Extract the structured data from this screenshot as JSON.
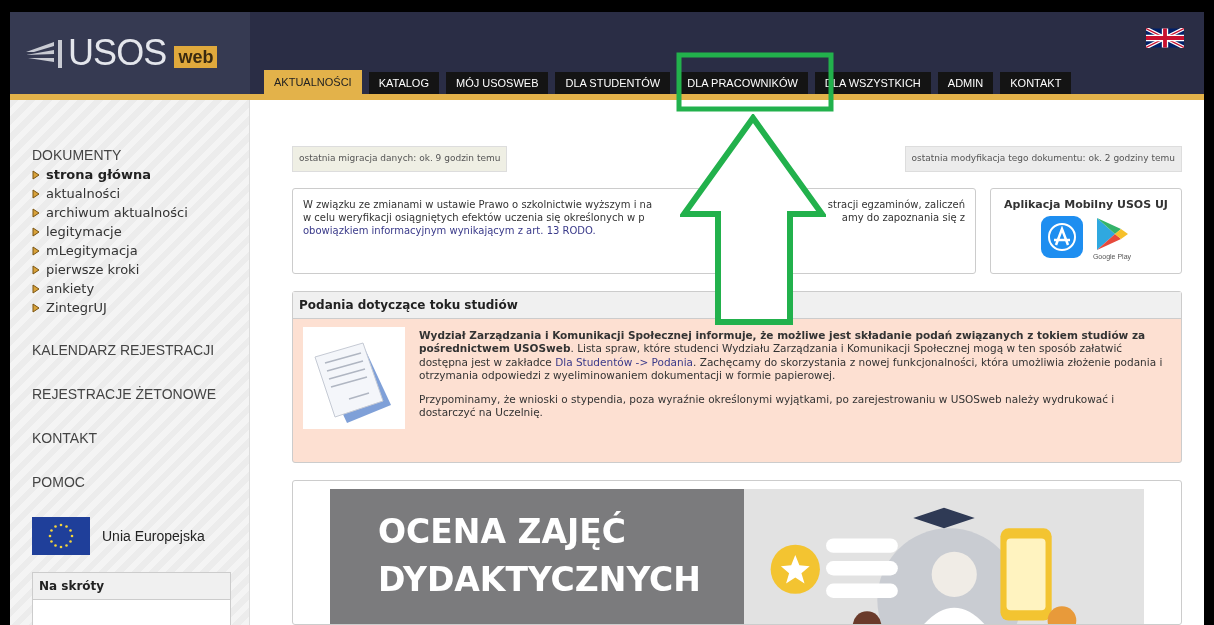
{
  "header": {
    "logo_text": "USOS",
    "logo_badge": "web"
  },
  "nav_tabs": [
    {
      "label": "AKTUALNOŚCI",
      "selected": true
    },
    {
      "label": "KATALOG",
      "selected": false
    },
    {
      "label": "MÓJ USOSWEB",
      "selected": false
    },
    {
      "label": "DLA STUDENTÓW",
      "selected": false
    },
    {
      "label": "DLA PRACOWNIKÓW",
      "selected": false
    },
    {
      "label": "DLA WSZYSTKICH",
      "selected": false
    },
    {
      "label": "ADMIN",
      "selected": false
    },
    {
      "label": "KONTAKT",
      "selected": false
    }
  ],
  "sidebar": {
    "sections": [
      {
        "title": "DOKUMENTY",
        "items": [
          {
            "label": "strona główna",
            "selected": true
          },
          {
            "label": "aktualności",
            "selected": false
          },
          {
            "label": "archiwum aktualności",
            "selected": false
          },
          {
            "label": "legitymacje",
            "selected": false
          },
          {
            "label": "mLegitymacja",
            "selected": false
          },
          {
            "label": "pierwsze kroki",
            "selected": false
          },
          {
            "label": "ankiety",
            "selected": false
          },
          {
            "label": "ZintegrUJ",
            "selected": false
          }
        ]
      },
      {
        "title": "KALENDARZ REJESTRACJI"
      },
      {
        "title": "REJESTRACJE ŻETONOWE"
      },
      {
        "title": "KONTAKT"
      },
      {
        "title": "POMOC"
      }
    ],
    "eu_label": "Unia Europejska",
    "shortcuts_title": "Na skróty"
  },
  "status": {
    "migration": "ostatnia migracja danych: ok. 9 godzin temu",
    "modification": "ostatnia modyfikacja tego dokumentu: ok. 2 godziny temu"
  },
  "notice": {
    "lines": [
      {
        "left": "W związku ze zmianami w ustawie Prawo o szkolnictwie wyższym i na",
        "right": "stracji egzaminów, zaliczeń"
      },
      {
        "left": "w celu weryfikacji osiągniętych efektów uczenia się określonych w p",
        "right": "amy do zapoznania się z"
      }
    ],
    "link": "obowiązkiem informacyjnym wynikającym z art. 13 RODO."
  },
  "app_box": {
    "title": "Aplikacja Mobilny USOS UJ",
    "store_label": "Google Play"
  },
  "podania": {
    "title": "Podania dotyczące toku studiów",
    "paragraphs": [
      [
        {
          "kind": "text",
          "text": "**Wydział Zarządzania i Komunikacji Społecznej informuje, że możliwe jest składanie podań związanych z tokiem studiów za pośrednictwem USOSweb**. Lista spraw, które studenci Wydziału Zarządzania i Komunikacji Społecznej mogą w ten sposób załatwić dostępna jest w zakładce "
        },
        {
          "kind": "link",
          "text": "Dla Studentów -> Podania"
        },
        {
          "kind": "text",
          "text": ". Zachęcamy do skorzystania z nowej funkcjonalności, która umożliwia złożenie podania i otrzymania odpowiedzi z wyeliminowaniem dokumentacji w formie papierowej."
        }
      ],
      [
        {
          "kind": "text",
          "text": "Przypominamy, że wnioski o stypendia, poza wyraźnie określonymi wyjątkami, po zarejestrowaniu w USOSweb należy wydrukować i dostarczyć na Uczelnię."
        }
      ]
    ]
  },
  "banner": {
    "title_lines": [
      "OCENA ZAJĘĆ",
      "DYDAKTYCZNYCH"
    ]
  }
}
